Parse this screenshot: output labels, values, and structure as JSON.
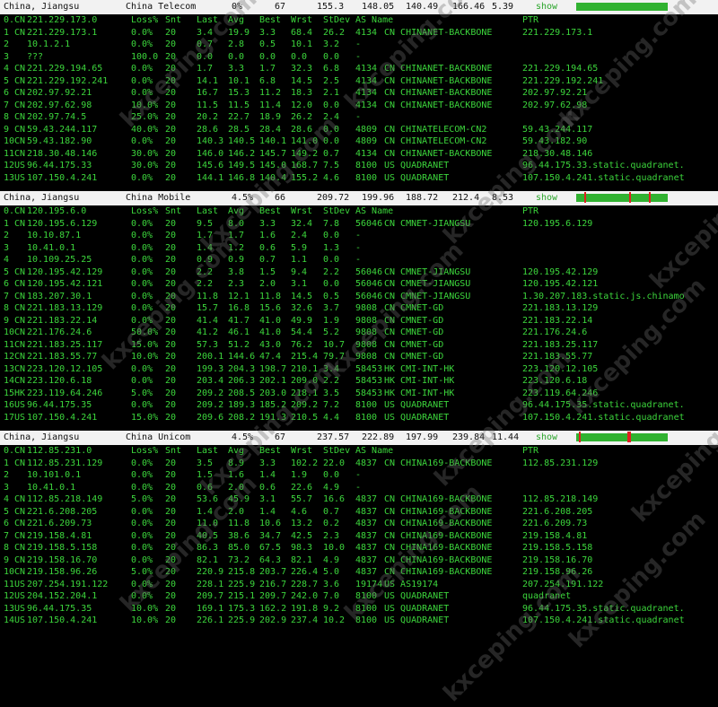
{
  "col_headers": [
    "Loss%",
    "Snt",
    "Last",
    "Avg",
    "Best",
    "Wrst",
    "StDev",
    "AS Name",
    "PTR"
  ],
  "sections": [
    {
      "location": "China, Jiangsu",
      "isp": "China Telecom",
      "loss": "0%",
      "snt": "67",
      "last": "155.3",
      "avg": "148.05",
      "best": "140.49",
      "wrst": "166.46",
      "stdev": "5.39",
      "show_label": "show",
      "spark_ticks": [],
      "hops": [
        {
          "n": "0.",
          "cc": "CN",
          "ip": "221.229.173.0",
          "loss": "Loss%",
          "snt": "Snt",
          "last": "Last",
          "avg": "Avg",
          "best": "Best",
          "wrst": "Wrst",
          "stdev": "StDev",
          "asn": "AS Name",
          "asname": "",
          "ptr": "PTR"
        },
        {
          "n": "1",
          "cc": "CN",
          "ip": "221.229.173.1",
          "loss": "0.0%",
          "snt": "20",
          "last": "3.4",
          "avg": "19.9",
          "best": "3.3",
          "wrst": "68.4",
          "stdev": "26.2",
          "asn": "4134",
          "asname": "CN CHINANET-BACKBONE",
          "ptr": "221.229.173.1"
        },
        {
          "n": "2",
          "cc": "",
          "ip": "10.1.2.1",
          "loss": "0.0%",
          "snt": "20",
          "last": "0.7",
          "avg": "2.8",
          "best": "0.5",
          "wrst": "10.1",
          "stdev": "3.2",
          "asn": "-",
          "asname": "",
          "ptr": ""
        },
        {
          "n": "3",
          "cc": "",
          "ip": "???",
          "loss": "100.0",
          "snt": "20",
          "last": "0.0",
          "avg": "0.0",
          "best": "0.0",
          "wrst": "0.0",
          "stdev": "0.0",
          "asn": "-",
          "asname": "",
          "ptr": ""
        },
        {
          "n": "4",
          "cc": "CN",
          "ip": "221.229.194.65",
          "loss": "0.0%",
          "snt": "20",
          "last": "1.7",
          "avg": "3.3",
          "best": "1.7",
          "wrst": "32.3",
          "stdev": "6.8",
          "asn": "4134",
          "asname": "CN CHINANET-BACKBONE",
          "ptr": "221.229.194.65"
        },
        {
          "n": "5",
          "cc": "CN",
          "ip": "221.229.192.241",
          "loss": "0.0%",
          "snt": "20",
          "last": "14.1",
          "avg": "10.1",
          "best": "6.8",
          "wrst": "14.5",
          "stdev": "2.5",
          "asn": "4134",
          "asname": "CN CHINANET-BACKBONE",
          "ptr": "221.229.192.241"
        },
        {
          "n": "6",
          "cc": "CN",
          "ip": "202.97.92.21",
          "loss": "0.0%",
          "snt": "20",
          "last": "16.7",
          "avg": "15.3",
          "best": "11.2",
          "wrst": "18.3",
          "stdev": "2.1",
          "asn": "4134",
          "asname": "CN CHINANET-BACKBONE",
          "ptr": "202.97.92.21"
        },
        {
          "n": "7",
          "cc": "CN",
          "ip": "202.97.62.98",
          "loss": "10.0%",
          "snt": "20",
          "last": "11.5",
          "avg": "11.5",
          "best": "11.4",
          "wrst": "12.0",
          "stdev": "0.0",
          "asn": "4134",
          "asname": "CN CHINANET-BACKBONE",
          "ptr": "202.97.62.98"
        },
        {
          "n": "8",
          "cc": "CN",
          "ip": "202.97.74.5",
          "loss": "25.0%",
          "snt": "20",
          "last": "20.2",
          "avg": "22.7",
          "best": "18.9",
          "wrst": "26.2",
          "stdev": "2.4",
          "asn": "-",
          "asname": "",
          "ptr": ""
        },
        {
          "n": "9",
          "cc": "CN",
          "ip": "59.43.244.117",
          "loss": "40.0%",
          "snt": "20",
          "last": "28.6",
          "avg": "28.5",
          "best": "28.4",
          "wrst": "28.6",
          "stdev": "0.0",
          "asn": "4809",
          "asname": "CN CHINATELECOM-CN2",
          "ptr": "59.43.244.117"
        },
        {
          "n": "10",
          "cc": "CN",
          "ip": "59.43.182.90",
          "loss": "0.0%",
          "snt": "20",
          "last": "140.3",
          "avg": "140.5",
          "best": "140.1",
          "wrst": "141.0",
          "stdev": "0.0",
          "asn": "4809",
          "asname": "CN CHINATELECOM-CN2",
          "ptr": "59.43.182.90"
        },
        {
          "n": "11",
          "cc": "CN",
          "ip": "218.30.48.146",
          "loss": "30.0%",
          "snt": "20",
          "last": "146.0",
          "avg": "146.2",
          "best": "145.7",
          "wrst": "149.2",
          "stdev": "0.7",
          "asn": "4134",
          "asname": "CN CHINANET-BACKBONE",
          "ptr": "218.30.48.146"
        },
        {
          "n": "12",
          "cc": "US",
          "ip": "96.44.175.33",
          "loss": "30.0%",
          "snt": "20",
          "last": "145.6",
          "avg": "149.5",
          "best": "145.0",
          "wrst": "168.7",
          "stdev": "7.5",
          "asn": "8100",
          "asname": "US QUADRANET",
          "ptr": "96.44.175.33.static.quadranet."
        },
        {
          "n": "13",
          "cc": "US",
          "ip": "107.150.4.241",
          "loss": "0.0%",
          "snt": "20",
          "last": "144.1",
          "avg": "146.8",
          "best": "140.4",
          "wrst": "155.2",
          "stdev": "4.6",
          "asn": "8100",
          "asname": "US QUADRANET",
          "ptr": "107.150.4.241.static.quadranet"
        }
      ]
    },
    {
      "location": "China, Jiangsu",
      "isp": "China Mobile",
      "loss": "4.5%",
      "snt": "66",
      "last": "209.72",
      "avg": "199.96",
      "best": "188.72",
      "wrst": "212.4",
      "stdev": "8.53",
      "show_label": "show",
      "spark_ticks": [
        0.09,
        0.58,
        0.79
      ],
      "hops": [
        {
          "n": "0.",
          "cc": "CN",
          "ip": "120.195.6.0",
          "loss": "Loss%",
          "snt": "Snt",
          "last": "Last",
          "avg": "Avg",
          "best": "Best",
          "wrst": "Wrst",
          "stdev": "StDev",
          "asn": "AS Name",
          "asname": "",
          "ptr": "PTR"
        },
        {
          "n": "1",
          "cc": "CN",
          "ip": "120.195.6.129",
          "loss": "0.0%",
          "snt": "20",
          "last": "9.5",
          "avg": "8.0",
          "best": "3.3",
          "wrst": "32.4",
          "stdev": "7.8",
          "asn": "56046",
          "asname": "CN CMNET-JIANGSU",
          "ptr": "120.195.6.129"
        },
        {
          "n": "2",
          "cc": "",
          "ip": "10.10.87.1",
          "loss": "0.0%",
          "snt": "20",
          "last": "1.7",
          "avg": "1.7",
          "best": "1.6",
          "wrst": "2.4",
          "stdev": "0.0",
          "asn": "-",
          "asname": "",
          "ptr": ""
        },
        {
          "n": "3",
          "cc": "",
          "ip": "10.41.0.1",
          "loss": "0.0%",
          "snt": "20",
          "last": "1.4",
          "avg": "1.2",
          "best": "0.6",
          "wrst": "5.9",
          "stdev": "1.3",
          "asn": "-",
          "asname": "",
          "ptr": ""
        },
        {
          "n": "4",
          "cc": "",
          "ip": "10.109.25.25",
          "loss": "0.0%",
          "snt": "20",
          "last": "0.9",
          "avg": "0.9",
          "best": "0.7",
          "wrst": "1.1",
          "stdev": "0.0",
          "asn": "-",
          "asname": "",
          "ptr": ""
        },
        {
          "n": "5",
          "cc": "CN",
          "ip": "120.195.42.129",
          "loss": "0.0%",
          "snt": "20",
          "last": "2.2",
          "avg": "3.8",
          "best": "1.5",
          "wrst": "9.4",
          "stdev": "2.2",
          "asn": "56046",
          "asname": "CN CMNET-JIANGSU",
          "ptr": "120.195.42.129"
        },
        {
          "n": "6",
          "cc": "CN",
          "ip": "120.195.42.121",
          "loss": "0.0%",
          "snt": "20",
          "last": "2.2",
          "avg": "2.3",
          "best": "2.0",
          "wrst": "3.1",
          "stdev": "0.0",
          "asn": "56046",
          "asname": "CN CMNET-JIANGSU",
          "ptr": "120.195.42.121"
        },
        {
          "n": "7",
          "cc": "CN",
          "ip": "183.207.30.1",
          "loss": "0.0%",
          "snt": "20",
          "last": "11.8",
          "avg": "12.1",
          "best": "11.8",
          "wrst": "14.5",
          "stdev": "0.5",
          "asn": "56046",
          "asname": "CN CMNET-JIANGSU",
          "ptr": "1.30.207.183.static.js.chinamo"
        },
        {
          "n": "8",
          "cc": "CN",
          "ip": "221.183.13.129",
          "loss": "0.0%",
          "snt": "20",
          "last": "15.7",
          "avg": "16.8",
          "best": "15.6",
          "wrst": "32.6",
          "stdev": "3.7",
          "asn": "9808",
          "asname": "CN CMNET-GD",
          "ptr": "221.183.13.129"
        },
        {
          "n": "9",
          "cc": "CN",
          "ip": "221.183.22.14",
          "loss": "0.0%",
          "snt": "20",
          "last": "41.4",
          "avg": "41.7",
          "best": "41.0",
          "wrst": "49.9",
          "stdev": "1.9",
          "asn": "9808",
          "asname": "CN CMNET-GD",
          "ptr": "221.183.22.14"
        },
        {
          "n": "10",
          "cc": "CN",
          "ip": "221.176.24.6",
          "loss": "50.0%",
          "snt": "20",
          "last": "41.2",
          "avg": "46.1",
          "best": "41.0",
          "wrst": "54.4",
          "stdev": "5.2",
          "asn": "9808",
          "asname": "CN CMNET-GD",
          "ptr": "221.176.24.6"
        },
        {
          "n": "11",
          "cc": "CN",
          "ip": "221.183.25.117",
          "loss": "15.0%",
          "snt": "20",
          "last": "57.3",
          "avg": "51.2",
          "best": "43.0",
          "wrst": "76.2",
          "stdev": "10.7",
          "asn": "9808",
          "asname": "CN CMNET-GD",
          "ptr": "221.183.25.117"
        },
        {
          "n": "12",
          "cc": "CN",
          "ip": "221.183.55.77",
          "loss": "10.0%",
          "snt": "20",
          "last": "200.1",
          "avg": "144.6",
          "best": "47.4",
          "wrst": "215.4",
          "stdev": "79.7",
          "asn": "9808",
          "asname": "CN CMNET-GD",
          "ptr": "221.183.55.77"
        },
        {
          "n": "13",
          "cc": "CN",
          "ip": "223.120.12.105",
          "loss": "0.0%",
          "snt": "20",
          "last": "199.3",
          "avg": "204.3",
          "best": "198.7",
          "wrst": "210.1",
          "stdev": "3.4",
          "asn": "58453",
          "asname": "HK CMI-INT-HK",
          "ptr": "223.120.12.105"
        },
        {
          "n": "14",
          "cc": "CN",
          "ip": "223.120.6.18",
          "loss": "0.0%",
          "snt": "20",
          "last": "203.4",
          "avg": "206.3",
          "best": "202.1",
          "wrst": "209.0",
          "stdev": "2.2",
          "asn": "58453",
          "asname": "HK CMI-INT-HK",
          "ptr": "223.120.6.18"
        },
        {
          "n": "15",
          "cc": "HK",
          "ip": "223.119.64.246",
          "loss": "5.0%",
          "snt": "20",
          "last": "209.2",
          "avg": "208.5",
          "best": "203.0",
          "wrst": "218.1",
          "stdev": "3.5",
          "asn": "58453",
          "asname": "HK CMI-INT-HK",
          "ptr": "223.119.64.246"
        },
        {
          "n": "16",
          "cc": "US",
          "ip": "96.44.175.35",
          "loss": "0.0%",
          "snt": "20",
          "last": "209.2",
          "avg": "189.3",
          "best": "185.2",
          "wrst": "209.2",
          "stdev": "7.2",
          "asn": "8100",
          "asname": "US QUADRANET",
          "ptr": "96.44.175.35.static.quadranet."
        },
        {
          "n": "17",
          "cc": "US",
          "ip": "107.150.4.241",
          "loss": "15.0%",
          "snt": "20",
          "last": "209.6",
          "avg": "208.2",
          "best": "191.3",
          "wrst": "210.5",
          "stdev": "4.4",
          "asn": "8100",
          "asname": "US QUADRANET",
          "ptr": "107.150.4.241.static.quadranet"
        }
      ]
    },
    {
      "location": "China, Jiangsu",
      "isp": "China Unicom",
      "loss": "4.5%",
      "snt": "67",
      "last": "237.57",
      "avg": "222.89",
      "best": "197.99",
      "wrst": "239.84",
      "stdev": "11.44",
      "show_label": "show",
      "spark_ticks": [
        0.03,
        0.56,
        0.58
      ],
      "hops": [
        {
          "n": "0.",
          "cc": "CN",
          "ip": "112.85.231.0",
          "loss": "Loss%",
          "snt": "Snt",
          "last": "Last",
          "avg": "Avg",
          "best": "Best",
          "wrst": "Wrst",
          "stdev": "StDev",
          "asn": "AS Name",
          "asname": "",
          "ptr": "PTR"
        },
        {
          "n": "1",
          "cc": "CN",
          "ip": "112.85.231.129",
          "loss": "0.0%",
          "snt": "20",
          "last": "3.5",
          "avg": "8.9",
          "best": "3.3",
          "wrst": "102.2",
          "stdev": "22.0",
          "asn": "4837",
          "asname": "CN CHINA169-BACKBONE",
          "ptr": "112.85.231.129"
        },
        {
          "n": "2",
          "cc": "",
          "ip": "10.101.0.1",
          "loss": "0.0%",
          "snt": "20",
          "last": "1.5",
          "avg": "1.6",
          "best": "1.4",
          "wrst": "1.9",
          "stdev": "0.0",
          "asn": "-",
          "asname": "",
          "ptr": ""
        },
        {
          "n": "3",
          "cc": "",
          "ip": "10.41.0.1",
          "loss": "0.0%",
          "snt": "20",
          "last": "0.6",
          "avg": "2.0",
          "best": "0.6",
          "wrst": "22.6",
          "stdev": "4.9",
          "asn": "-",
          "asname": "",
          "ptr": ""
        },
        {
          "n": "4",
          "cc": "CN",
          "ip": "112.85.218.149",
          "loss": "5.0%",
          "snt": "20",
          "last": "53.6",
          "avg": "45.9",
          "best": "3.1",
          "wrst": "55.7",
          "stdev": "16.6",
          "asn": "4837",
          "asname": "CN CHINA169-BACKBONE",
          "ptr": "112.85.218.149"
        },
        {
          "n": "5",
          "cc": "CN",
          "ip": "221.6.208.205",
          "loss": "0.0%",
          "snt": "20",
          "last": "1.4",
          "avg": "2.0",
          "best": "1.4",
          "wrst": "4.6",
          "stdev": "0.7",
          "asn": "4837",
          "asname": "CN CHINA169-BACKBONE",
          "ptr": "221.6.208.205"
        },
        {
          "n": "6",
          "cc": "CN",
          "ip": "221.6.209.73",
          "loss": "0.0%",
          "snt": "20",
          "last": "11.0",
          "avg": "11.8",
          "best": "10.6",
          "wrst": "13.2",
          "stdev": "0.2",
          "asn": "4837",
          "asname": "CN CHINA169-BACKBONE",
          "ptr": "221.6.209.73"
        },
        {
          "n": "7",
          "cc": "CN",
          "ip": "219.158.4.81",
          "loss": "0.0%",
          "snt": "20",
          "last": "40.5",
          "avg": "38.6",
          "best": "34.7",
          "wrst": "42.5",
          "stdev": "2.3",
          "asn": "4837",
          "asname": "CN CHINA169-BACKBONE",
          "ptr": "219.158.4.81"
        },
        {
          "n": "8",
          "cc": "CN",
          "ip": "219.158.5.158",
          "loss": "0.0%",
          "snt": "20",
          "last": "86.3",
          "avg": "85.0",
          "best": "67.5",
          "wrst": "98.3",
          "stdev": "10.0",
          "asn": "4837",
          "asname": "CN CHINA169-BACKBONE",
          "ptr": "219.158.5.158"
        },
        {
          "n": "9",
          "cc": "CN",
          "ip": "219.158.16.70",
          "loss": "0.0%",
          "snt": "20",
          "last": "82.1",
          "avg": "73.2",
          "best": "64.3",
          "wrst": "82.1",
          "stdev": "4.9",
          "asn": "4837",
          "asname": "CN CHINA169-BACKBONE",
          "ptr": "219.158.16.70"
        },
        {
          "n": "10",
          "cc": "CN",
          "ip": "219.158.96.26",
          "loss": "5.0%",
          "snt": "20",
          "last": "220.9",
          "avg": "215.8",
          "best": "203.7",
          "wrst": "226.4",
          "stdev": "5.0",
          "asn": "4837",
          "asname": "CN CHINA169-BACKBONE",
          "ptr": "219.158.96.26"
        },
        {
          "n": "11",
          "cc": "US",
          "ip": "207.254.191.122",
          "loss": "0.0%",
          "snt": "20",
          "last": "228.1",
          "avg": "225.9",
          "best": "216.7",
          "wrst": "228.7",
          "stdev": "3.6",
          "asn": "19174",
          "asname": "US AS19174",
          "ptr": "207.254.191.122"
        },
        {
          "n": "12",
          "cc": "US",
          "ip": "204.152.204.1",
          "loss": "0.0%",
          "snt": "20",
          "last": "209.7",
          "avg": "215.1",
          "best": "209.7",
          "wrst": "242.0",
          "stdev": "7.0",
          "asn": "8100",
          "asname": "US QUADRANET",
          "ptr": "quadranet"
        },
        {
          "n": "13",
          "cc": "US",
          "ip": "96.44.175.35",
          "loss": "10.0%",
          "snt": "20",
          "last": "169.1",
          "avg": "175.3",
          "best": "162.2",
          "wrst": "191.8",
          "stdev": "9.2",
          "asn": "8100",
          "asname": "US QUADRANET",
          "ptr": "96.44.175.35.static.quadranet."
        },
        {
          "n": "14",
          "cc": "US",
          "ip": "107.150.4.241",
          "loss": "10.0%",
          "snt": "20",
          "last": "226.1",
          "avg": "225.9",
          "best": "202.9",
          "wrst": "237.4",
          "stdev": "10.2",
          "asn": "8100",
          "asname": "US QUADRANET",
          "ptr": "107.150.4.241.static.quadranet"
        }
      ]
    }
  ],
  "watermark": "kxceping.com"
}
